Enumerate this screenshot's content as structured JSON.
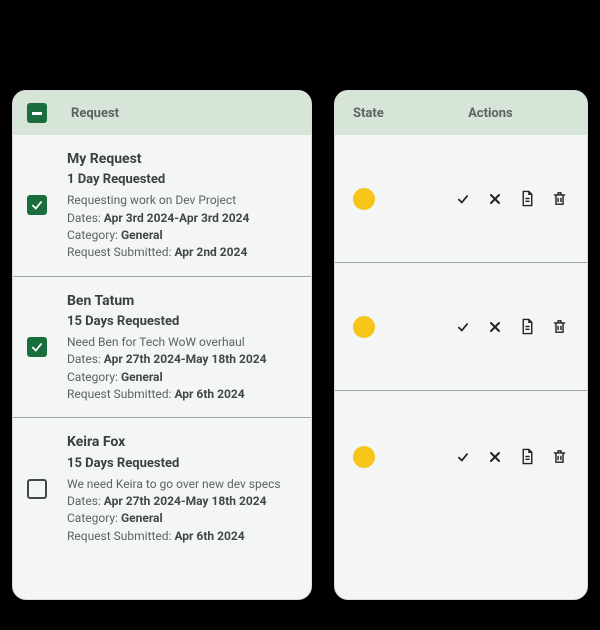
{
  "headers": {
    "request": "Request",
    "state": "State",
    "actions": "Actions"
  },
  "labels": {
    "dates_prefix": "Dates: ",
    "category_prefix": "Category: ",
    "submitted_prefix": "Request Submitted: "
  },
  "colors": {
    "accent_green": "#1a6e3e",
    "header_bg": "#d6e5d7",
    "panel_bg": "#f4f6f6",
    "state_pending": "#f5c518"
  },
  "icons": {
    "approve": "check-icon",
    "reject": "close-icon",
    "detail": "document-icon",
    "delete": "trash-icon"
  },
  "rows": [
    {
      "checked": true,
      "title": "My Request",
      "days": "1 Day Requested",
      "desc": "Requesting work on Dev Project",
      "dates": "Apr 3rd 2024-Apr 3rd 2024",
      "category": "General",
      "submitted": "Apr 2nd 2024",
      "state": "pending"
    },
    {
      "checked": true,
      "title": "Ben Tatum",
      "days": "15 Days Requested",
      "desc": "Need Ben for Tech WoW overhaul",
      "dates": "Apr 27th 2024-May 18th 2024",
      "category": "General",
      "submitted": "Apr 6th 2024",
      "state": "pending"
    },
    {
      "checked": false,
      "title": "Keira Fox",
      "days": "15 Days Requested",
      "desc": "We need Keira to go over new dev specs",
      "dates": "Apr 27th 2024-May 18th 2024",
      "category": "General",
      "submitted": "Apr 6th 2024",
      "state": "pending"
    }
  ]
}
